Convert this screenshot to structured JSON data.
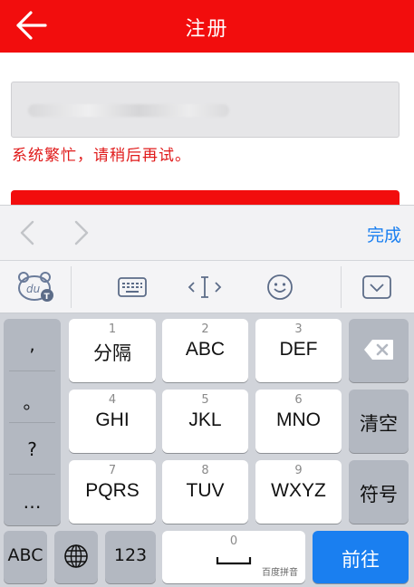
{
  "header": {
    "title": "注册",
    "back_icon": "arrow-left-icon"
  },
  "form": {
    "error_message": "系统繁忙，请稍后再试。"
  },
  "accessory": {
    "done_label": "完成"
  },
  "keyboard": {
    "punctuation": [
      ",",
      "。",
      "?",
      "…"
    ],
    "keys": [
      {
        "num": "1",
        "letters": "分隔"
      },
      {
        "num": "2",
        "letters": "ABC"
      },
      {
        "num": "3",
        "letters": "DEF"
      },
      {
        "num": "4",
        "letters": "GHI"
      },
      {
        "num": "5",
        "letters": "JKL"
      },
      {
        "num": "6",
        "letters": "MNO"
      },
      {
        "num": "7",
        "letters": "PQRS"
      },
      {
        "num": "8",
        "letters": "TUV"
      },
      {
        "num": "9",
        "letters": "WXYZ"
      }
    ],
    "clear_label": "清空",
    "symbol_label": "符号",
    "abc_label": "ABC",
    "num_label": "123",
    "space_num": "0",
    "space_brand": "百度拼音",
    "go_label": "前往"
  },
  "colors": {
    "brand_red": "#f20d0d",
    "ios_blue": "#1a7ff0"
  }
}
